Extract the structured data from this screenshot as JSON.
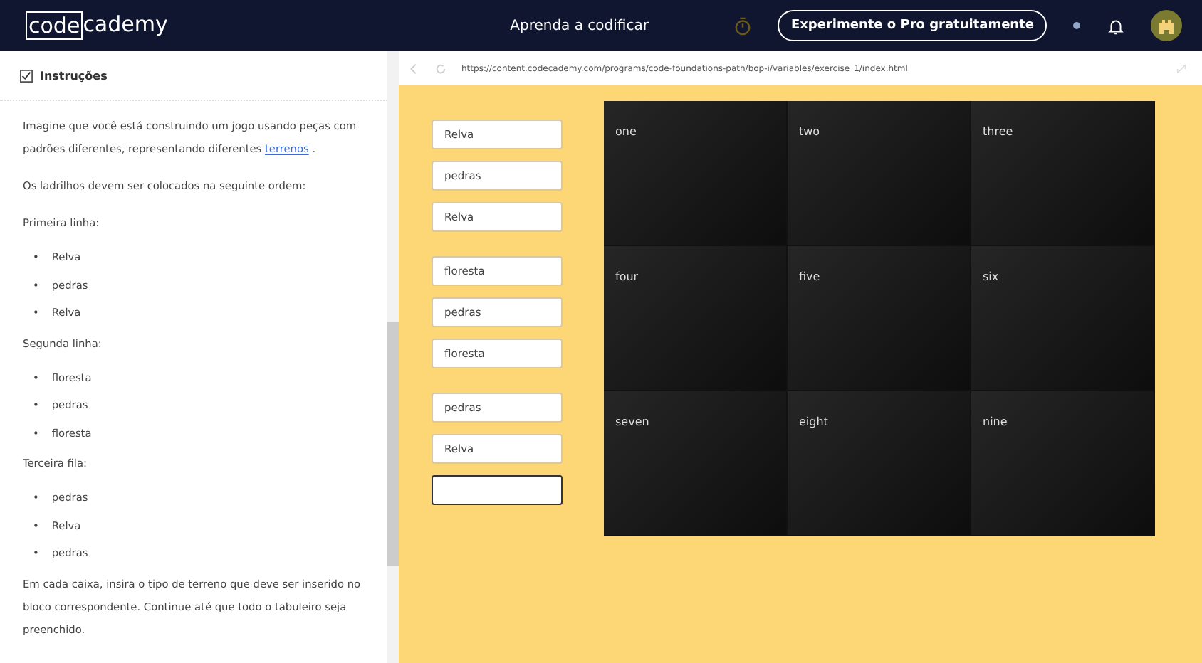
{
  "header": {
    "logo_boxed": "code",
    "logo_rest": "cademy",
    "title": "Aprenda a codificar",
    "cta": "Experimente o Pro gratuitamente"
  },
  "instructions": {
    "heading": "Instruções",
    "checked": true,
    "blocks": [
      {
        "kind": "para",
        "text": "Imagine que você está construindo um jogo usando peças com padrões diferentes, representando diferentes",
        "link": "terrenos",
        "after": "."
      },
      {
        "kind": "para",
        "text": "Os ladrilhos devem ser colocados na seguinte ordem:"
      },
      {
        "kind": "para",
        "text": "Primeira linha:"
      },
      {
        "kind": "list",
        "bullet": "•",
        "items": [
          "Relva",
          "pedras",
          "Relva"
        ]
      },
      {
        "kind": "para",
        "text": "Segunda linha:"
      },
      {
        "kind": "list",
        "bullet": "•",
        "items": [
          "floresta",
          "pedras",
          "floresta"
        ]
      },
      {
        "kind": "para",
        "text": "Terceira fila:"
      },
      {
        "kind": "list",
        "bullet": "•",
        "items": [
          "pedras",
          "Relva",
          "pedras"
        ]
      },
      {
        "kind": "para",
        "text": "Em cada caixa, insira o tipo de terreno que deve ser inserido no bloco correspondente. Continue até que todo o tabuleiro seja preenchido."
      }
    ]
  },
  "browser": {
    "url": "https://content.codecademy.com/programs/code-foundations-path/bop-i/variables/exercise_1/index.html"
  },
  "input_groups": [
    [
      {
        "value": "Relva",
        "focused": false
      },
      {
        "value": "pedras",
        "focused": false
      },
      {
        "value": "Relva",
        "focused": false
      }
    ],
    [
      {
        "value": "floresta",
        "focused": false
      },
      {
        "value": "pedras",
        "focused": false
      },
      {
        "value": "floresta",
        "focused": false
      }
    ],
    [
      {
        "value": "pedras",
        "focused": false
      },
      {
        "value": "Relva",
        "focused": false
      },
      {
        "focused": true
      }
    ]
  ],
  "tiles": [
    "one",
    "two",
    "three",
    "four",
    "five",
    "six",
    "seven",
    "eight",
    "nine"
  ]
}
